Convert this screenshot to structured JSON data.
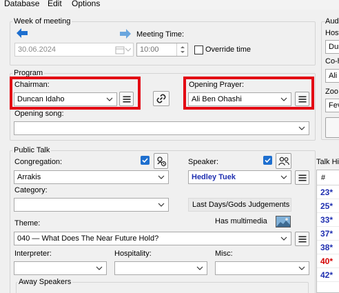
{
  "menu": [
    "Database",
    "Edit",
    "Options"
  ],
  "week": {
    "title": "Week of meeting",
    "date": "30.06.2024",
    "meeting_time_label": "Meeting Time:",
    "time": "10:00",
    "override_label": "Override time",
    "override_checked": false
  },
  "audio": {
    "title": "Aud",
    "host_label": "Host",
    "host_value": "Dun",
    "cohost_label": "Co-h",
    "cohost_value": "Ali",
    "zoom_label": "Zoo",
    "zoom_value": "Fev"
  },
  "program": {
    "title": "Program",
    "chairman_label": "Chairman:",
    "chairman_value": "Duncan Idaho",
    "prayer_label": "Opening Prayer:",
    "prayer_value": "Ali Ben Ohashi",
    "song_label": "Opening song:",
    "song_value": ""
  },
  "public_talk": {
    "title": "Public Talk",
    "congregation_label": "Congregation:",
    "congregation_value": "Arrakis",
    "congregation_checked": true,
    "category_label": "Category:",
    "category_value": "",
    "speaker_label": "Speaker:",
    "speaker_value": "Hedley Tuek",
    "speaker_checked": true,
    "category_chip": "Last Days/Gods Judgements",
    "multimedia_label": "Has multimedia",
    "theme_label": "Theme:",
    "theme_value": "040 — What Does The Near Future Hold?",
    "interpreter_label": "Interpreter:",
    "hospitality_label": "Hospitality:",
    "misc_label": "Misc:",
    "away_label": "Away Speakers"
  },
  "talk_history": {
    "title": "Talk His",
    "header": "#",
    "rows": [
      {
        "value": "23*",
        "color": "#1f2fb0"
      },
      {
        "value": "25*",
        "color": "#1f2fb0"
      },
      {
        "value": "33*",
        "color": "#1f2fb0"
      },
      {
        "value": "37*",
        "color": "#1f2fb0"
      },
      {
        "value": "38*",
        "color": "#1f2fb0"
      },
      {
        "value": "40*",
        "color": "#d40000"
      },
      {
        "value": "42*",
        "color": "#1f2fb0"
      }
    ]
  },
  "colors": {
    "highlight_border": "#e30613",
    "speaker_text": "#1f2fb0",
    "nav_arrow": "#1e6fcf",
    "checkbox_blue": "#1e6fcf"
  }
}
